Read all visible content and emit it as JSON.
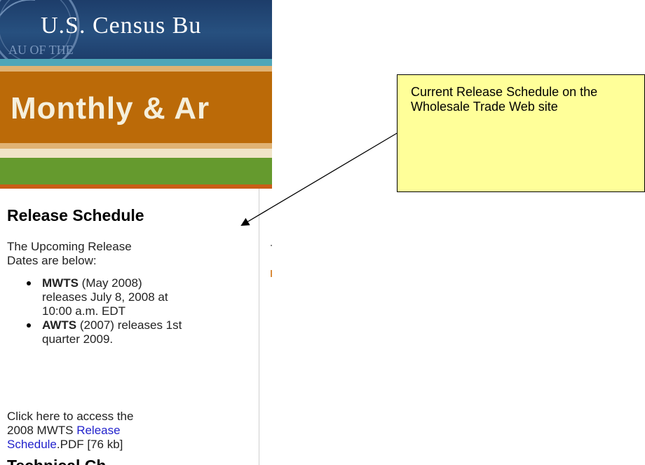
{
  "banner": {
    "agency_title": "U.S. Census Bu",
    "seal_text": "AU OF THE",
    "survey_title": "Monthly & Ar"
  },
  "sidebar": {
    "heading": "Release Schedule",
    "intro": "The Upcoming Release Dates are below:",
    "releases": [
      {
        "name": "MWTS",
        "detail": " (May 2008) releases July 8, 2008 at 10:00 a.m. EDT"
      },
      {
        "name": "AWTS",
        "detail": " (2007) releases 1st quarter 2009."
      }
    ],
    "access_prefix": "Click here to access the 2008 MWTS ",
    "access_link": "Release Schedule",
    "access_suffix": ".PDF [76 kb]",
    "next_heading": "Technical Ch"
  },
  "callout": {
    "text": "Current Release Schedule on the Wholesale Trade Web site"
  },
  "colors": {
    "banner_blue": "#1d3d6a",
    "orange_band": "#bb6a08",
    "green_band": "#659a2e",
    "callout_fill": "#ffff99",
    "link": "#2222cc"
  }
}
